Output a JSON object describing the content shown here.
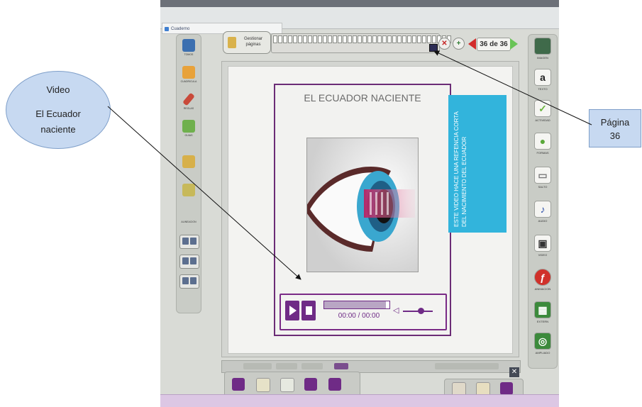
{
  "app": {
    "tab_title": "Cuaderno"
  },
  "left_panel": {
    "tools": [
      {
        "label": "TOMOS",
        "icon": "books-icon",
        "color": "#3b6fb0"
      },
      {
        "label": "CUADRICULA",
        "icon": "grid-icon",
        "color": "#e8a23a"
      },
      {
        "label": "REGLAS",
        "icon": "ruler-icon",
        "color": "#c94a3a"
      },
      {
        "label": "GUIAS",
        "icon": "guides-icon",
        "color": "#6fb04d"
      },
      {
        "label": "",
        "icon": "move-up-icon",
        "color": "#d7b04a"
      },
      {
        "label": "",
        "icon": "move-down-icon",
        "color": "#c7b95a"
      }
    ],
    "section_label": "ALINEACION"
  },
  "toolbar": {
    "manage_pages_label": "Gestionar páginas",
    "page_counter": "36 de 36"
  },
  "slide": {
    "title": "EL ECUADOR NACIENTE",
    "side_text": "ESTE VIDEO HACE UNA REFENCIA CORTA DEL NACIMIENTO DEL ECUADOR"
  },
  "player": {
    "time": "00:00 / 00:00",
    "progress": 0.95,
    "volume": 0.6
  },
  "right_panel": {
    "tools": [
      {
        "label": "IMAGEN",
        "glyph": "",
        "icon": "image-icon",
        "color": "#3f6a4a"
      },
      {
        "label": "TEXTO",
        "glyph": "a",
        "icon": "text-icon",
        "color": "#222222"
      },
      {
        "label": "ACTIVIDAD",
        "glyph": "✓",
        "icon": "activity-icon",
        "color": "#6ab43c"
      },
      {
        "label": "FORMAS",
        "glyph": "●",
        "icon": "shapes-icon",
        "color": "#5aa83a"
      },
      {
        "label": "SALTO",
        "glyph": "▭",
        "icon": "jump-icon",
        "color": "#7a7a7a"
      },
      {
        "label": "AUDIO",
        "glyph": "♪",
        "icon": "audio-icon",
        "color": "#2c4fa8"
      },
      {
        "label": "VIDEO",
        "glyph": "▣",
        "icon": "video-icon",
        "color": "#333333"
      },
      {
        "label": "ANIMACION",
        "glyph": "ƒ",
        "icon": "flash-icon",
        "color": "#d0312a"
      },
      {
        "label": "EXTERN",
        "glyph": "▦",
        "icon": "external-icon",
        "color": "#3c8a3c"
      },
      {
        "label": "AMPLIADO",
        "glyph": "◎",
        "icon": "zoom-icon",
        "color": "#3c8a3c"
      }
    ]
  },
  "annotations": {
    "video": {
      "line1": "Video",
      "line2": "El Ecuador",
      "line3": "naciente"
    },
    "page": {
      "line1": "Página",
      "line2": "36"
    }
  },
  "colors": {
    "purple": "#6f2b86",
    "cyan": "#32b4dc",
    "callout_fill": "#c7d9f1"
  }
}
